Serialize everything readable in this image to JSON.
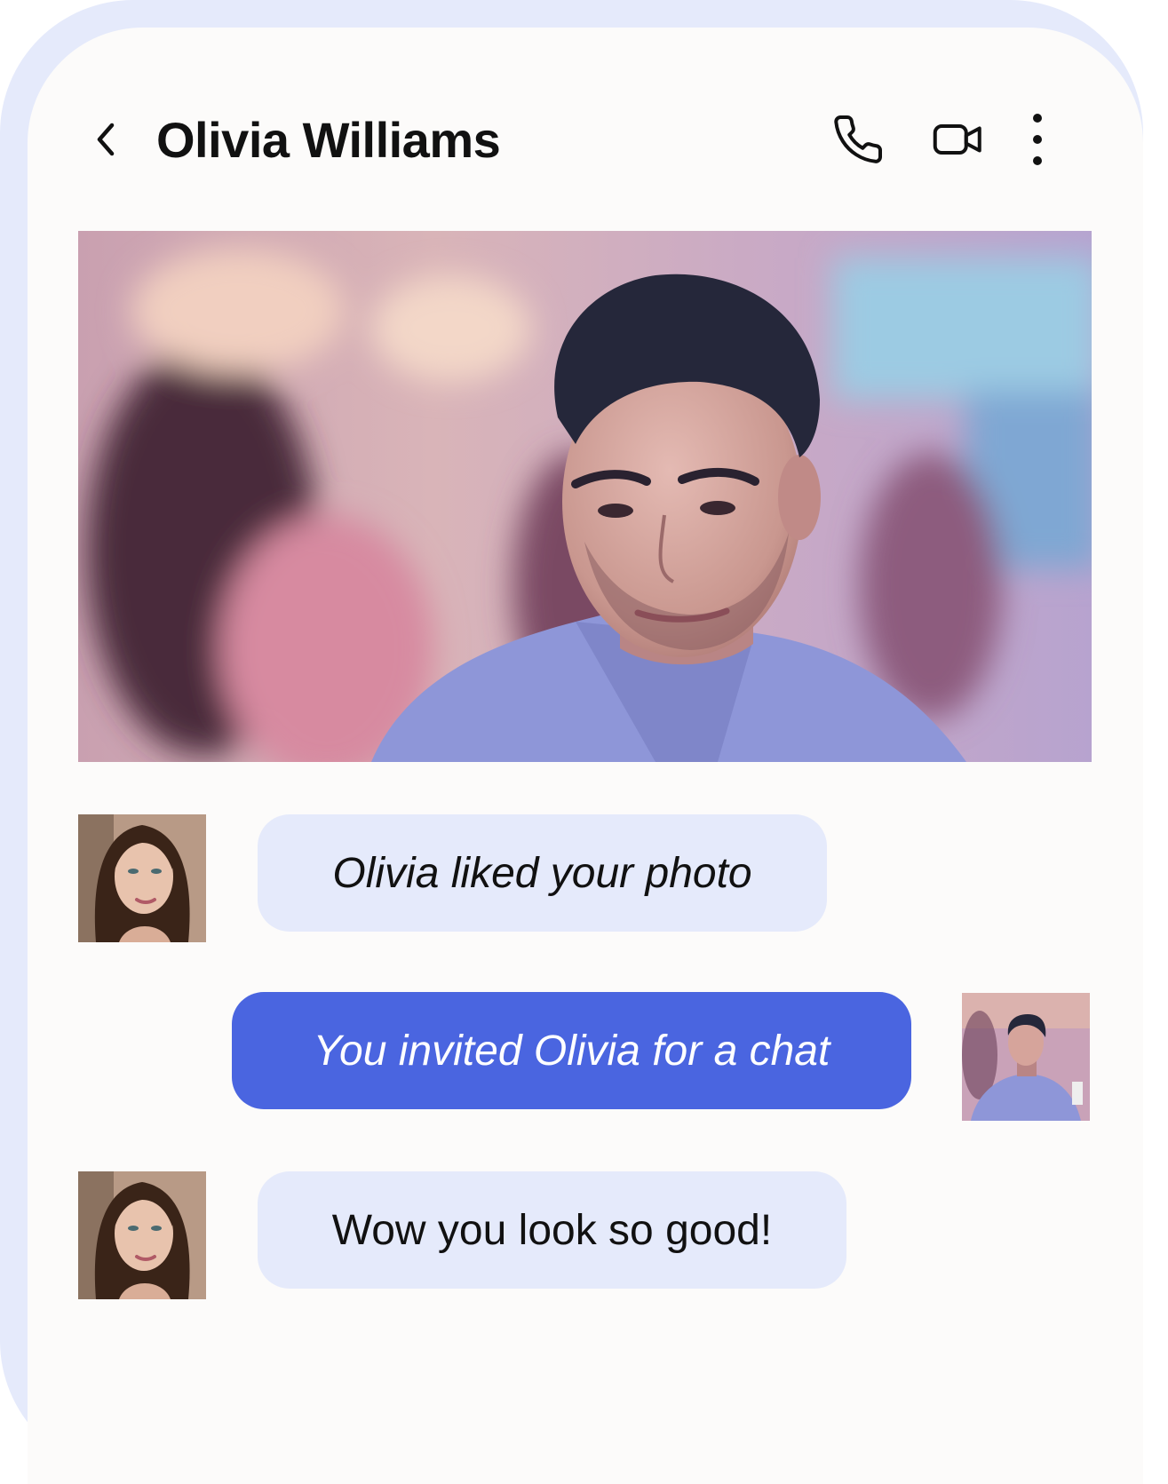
{
  "header": {
    "contact_name": "Olivia Williams",
    "back_icon": "chevron-left-icon",
    "call_icon": "phone-icon",
    "video_icon": "video-camera-icon",
    "more_icon": "more-vertical-icon"
  },
  "shared_photo": {
    "subject": "photo of a man"
  },
  "messages": [
    {
      "sender": "Olivia",
      "direction": "incoming",
      "text": "Olivia liked your photo",
      "style": "italic"
    },
    {
      "sender": "You",
      "direction": "outgoing",
      "text": "You invited Olivia for a chat",
      "style": "italic"
    },
    {
      "sender": "Olivia",
      "direction": "incoming",
      "text": "Wow you look so good!",
      "style": "normal"
    }
  ],
  "colors": {
    "frame": "#e5eafb",
    "screen_bg": "#fcfbfa",
    "incoming_bubble": "#e5eafb",
    "outgoing_bubble": "#4a65e0",
    "text_dark": "#111111",
    "text_light": "#ffffff"
  }
}
